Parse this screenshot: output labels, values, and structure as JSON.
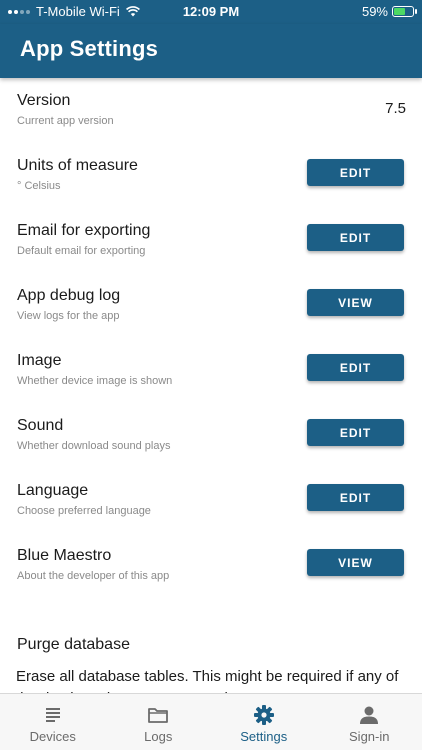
{
  "status_bar": {
    "carrier": "T-Mobile Wi-Fi",
    "time": "12:09 PM",
    "battery": "59%"
  },
  "header": {
    "title": "App Settings"
  },
  "settings": [
    {
      "label": "Version",
      "description": "Current app version",
      "value": "7.5"
    },
    {
      "label": "Units of measure",
      "description": "° Celsius",
      "button": "EDIT"
    },
    {
      "label": "Email for exporting",
      "description": "Default email for exporting",
      "button": "EDIT"
    },
    {
      "label": "App debug log",
      "description": "View logs for the app",
      "button": "VIEW"
    },
    {
      "label": "Image",
      "description": "Whether device image is shown",
      "button": "EDIT"
    },
    {
      "label": "Sound",
      "description": "Whether download sound plays",
      "button": "EDIT"
    },
    {
      "label": "Language",
      "description": "Choose preferred language",
      "button": "EDIT"
    },
    {
      "label": "Blue Maestro",
      "description": "About the developer of this app",
      "button": "VIEW"
    }
  ],
  "purge": {
    "label": "Purge database",
    "text": "Erase all database tables. This might be required if any of the database become corrupted."
  },
  "tabs": [
    {
      "label": "Devices",
      "icon": "list-icon",
      "active": false
    },
    {
      "label": "Logs",
      "icon": "folder-icon",
      "active": false
    },
    {
      "label": "Settings",
      "icon": "gear-icon",
      "active": true
    },
    {
      "label": "Sign-in",
      "icon": "person-icon",
      "active": false
    }
  ],
  "colors": {
    "primary": "#1c5f86",
    "battery": "#4cd964",
    "tab_inactive": "#6b6b6b"
  }
}
